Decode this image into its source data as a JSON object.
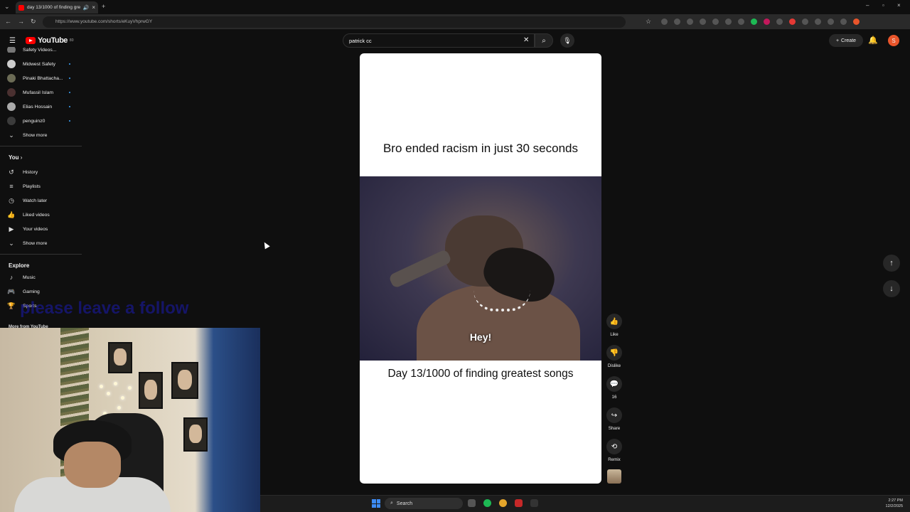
{
  "browser": {
    "tab_title": "day 13/1000 of finding gre...",
    "url": "https://www.youtube.com/shorts/eKuyVhprwGY"
  },
  "header": {
    "logo": "YouTube",
    "logo_badge": "80",
    "search_value": "patrick cc",
    "create_label": "Create",
    "avatar_letter": "S"
  },
  "sidebar": {
    "subscriptions": [
      {
        "label": "Safety Videos..."
      },
      {
        "label": "Midwest Safety"
      },
      {
        "label": "Pinaki Bhattacha..."
      },
      {
        "label": "Mufassil Islam"
      },
      {
        "label": "Elias Hossain"
      },
      {
        "label": "penguinz0"
      }
    ],
    "subs_show_more": "Show more",
    "you_heading": "You",
    "you_items": [
      {
        "label": "History",
        "icon": "history-icon"
      },
      {
        "label": "Playlists",
        "icon": "playlists-icon"
      },
      {
        "label": "Watch later",
        "icon": "clock-icon"
      },
      {
        "label": "Liked videos",
        "icon": "thumbs-up-icon"
      },
      {
        "label": "Your videos",
        "icon": "video-icon"
      }
    ],
    "you_show_more": "Show more",
    "explore_heading": "Explore",
    "explore_items": [
      {
        "label": "Music",
        "icon": "music-note-icon"
      },
      {
        "label": "Gaming",
        "icon": "gamepad-icon"
      },
      {
        "label": "Sports",
        "icon": "trophy-icon"
      }
    ],
    "more_from": "More from YouTube"
  },
  "overlay_text": "please leave a follow",
  "short": {
    "top_caption": "Bro ended racism in just 30 seconds",
    "video_subtitle": "Hey!",
    "bottom_caption": "Day 13/1000 of finding greatest songs"
  },
  "actions": {
    "like": "Like",
    "dislike": "Dislike",
    "comments": "16",
    "share": "Share",
    "remix": "Remix"
  },
  "taskbar": {
    "search": "Search",
    "time": "2:27 PM",
    "date": "12/2/2025"
  }
}
